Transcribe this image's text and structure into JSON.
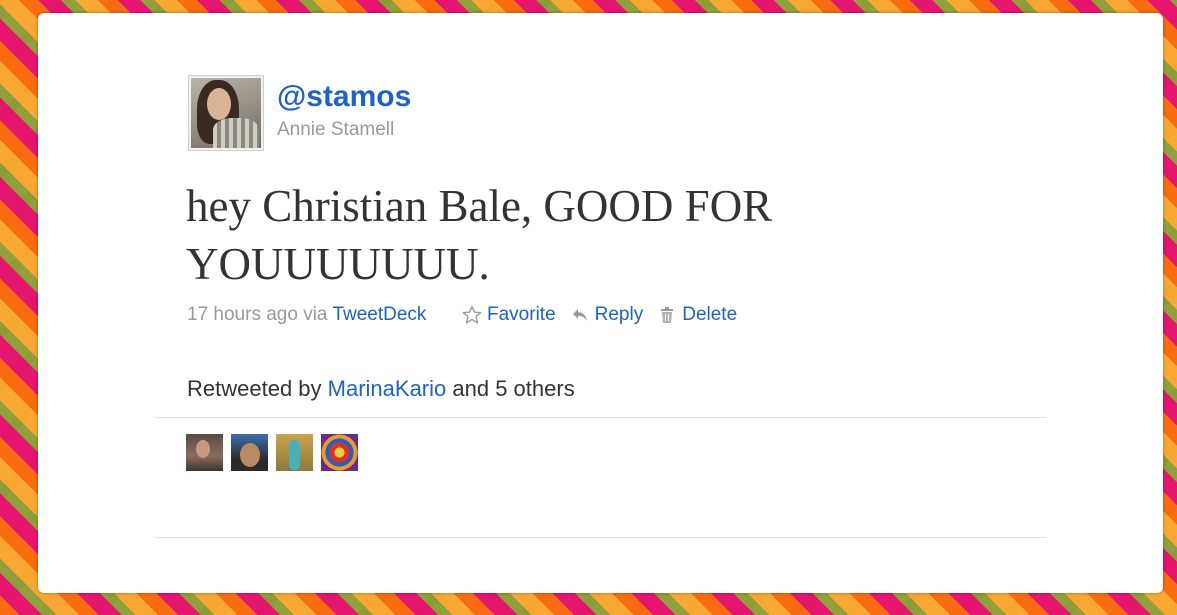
{
  "tweet": {
    "screen_name": "@stamos",
    "full_name": "Annie Stamell",
    "text": "hey Christian Bale, GOOD FOR YOUUUUUUU.",
    "timestamp": "17 hours ago",
    "via_label": "via",
    "source": "TweetDeck"
  },
  "actions": {
    "favorite_label": "Favorite",
    "reply_label": "Reply",
    "delete_label": "Delete"
  },
  "retweets": {
    "prefix": "Retweeted by",
    "user": "MarinaKario",
    "suffix": "and 5 others"
  },
  "icons": {
    "favorite": "star-outline-icon",
    "reply": "reply-arrow-icon",
    "delete": "trash-icon"
  },
  "colors": {
    "link": "#1f62c4",
    "muted": "#999999",
    "text": "#333333"
  }
}
